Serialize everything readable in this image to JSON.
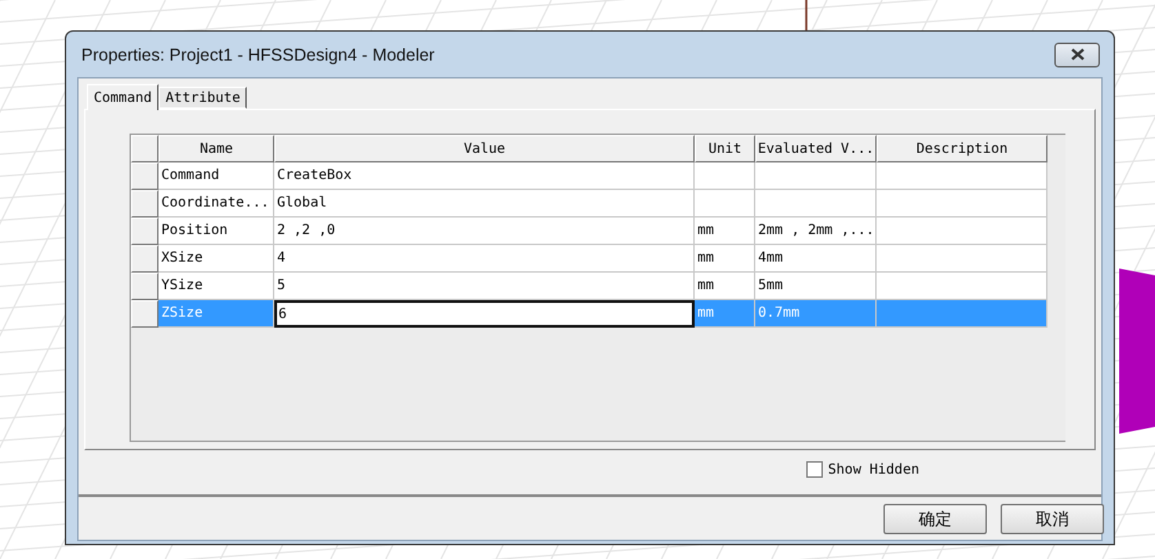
{
  "window": {
    "title": "Properties: Project1 - HFSSDesign4 - Modeler"
  },
  "tabs": [
    {
      "label": "Command",
      "selected": true
    },
    {
      "label": "Attribute",
      "selected": false
    }
  ],
  "table": {
    "columns": [
      "Name",
      "Value",
      "Unit",
      "Evaluated V...",
      "Description"
    ],
    "rows": [
      {
        "name": "Command",
        "value": "CreateBox",
        "unit": "",
        "evaluated": "",
        "description": "",
        "selected": false
      },
      {
        "name": "Coordinate...",
        "value": "Global",
        "unit": "",
        "evaluated": "",
        "description": "",
        "selected": false
      },
      {
        "name": "Position",
        "value": "2 ,2 ,0",
        "unit": "mm",
        "evaluated": "2mm , 2mm ,...",
        "description": "",
        "selected": false
      },
      {
        "name": "XSize",
        "value": "4",
        "unit": "mm",
        "evaluated": "4mm",
        "description": "",
        "selected": false
      },
      {
        "name": "YSize",
        "value": "5",
        "unit": "mm",
        "evaluated": "5mm",
        "description": "",
        "selected": false
      },
      {
        "name": "ZSize",
        "value": "6",
        "unit": "mm",
        "evaluated": "0.7mm",
        "description": "",
        "selected": true
      }
    ]
  },
  "show_hidden": {
    "label": "Show Hidden",
    "checked": false
  },
  "buttons": [
    "确定",
    "取消"
  ]
}
